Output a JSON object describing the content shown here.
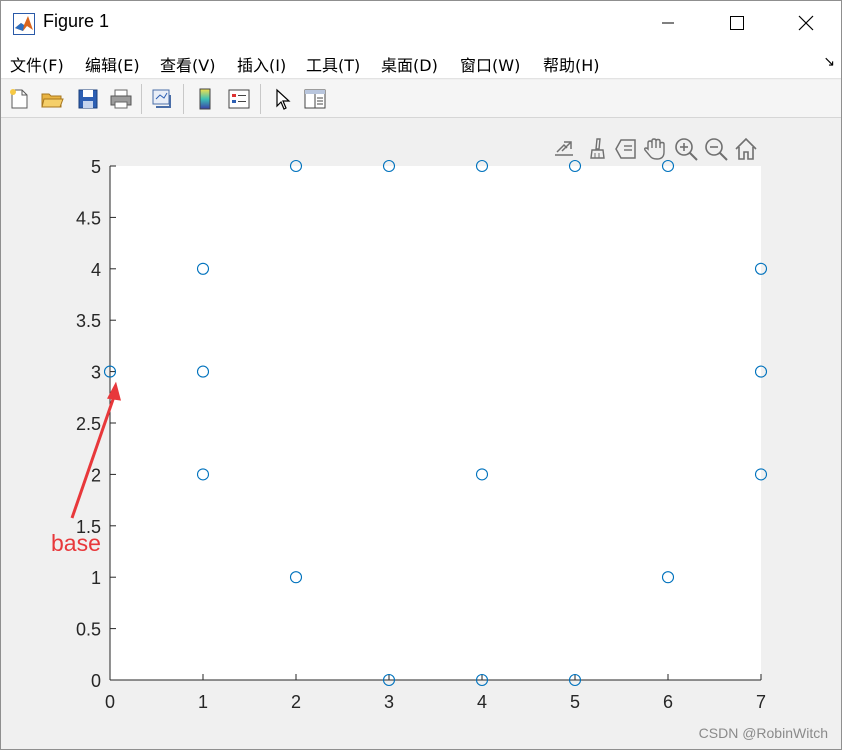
{
  "window": {
    "title": "Figure 1",
    "icon": "matlab-logo-icon"
  },
  "menu": [
    {
      "label": "文件(F)"
    },
    {
      "label": "编辑(E)"
    },
    {
      "label": "查看(V)"
    },
    {
      "label": "插入(I)"
    },
    {
      "label": "工具(T)"
    },
    {
      "label": "桌面(D)"
    },
    {
      "label": "窗口(W)"
    },
    {
      "label": "帮助(H)"
    }
  ],
  "toolbar": [
    "new-figure-icon",
    "open-file-icon",
    "save-icon",
    "print-icon",
    "link-plot-icon",
    "insert-colorbar-icon",
    "insert-legend-icon",
    "edit-plot-arrow-icon",
    "property-inspector-icon"
  ],
  "axes_toolbar": [
    "export-icon",
    "brush-icon",
    "data-tips-icon",
    "pan-hand-icon",
    "zoom-in-icon",
    "zoom-out-icon",
    "restore-view-home-icon"
  ],
  "annotation": {
    "text": "base",
    "color": "#e8383b"
  },
  "watermark": "CSDN @RobinWitch",
  "colors": {
    "marker": "#0072BD",
    "axes_bg": "#ffffff",
    "figure_bg": "#f0f0f0"
  },
  "chart_data": {
    "type": "scatter",
    "marker": "circle",
    "x": [
      0,
      1,
      1,
      1,
      2,
      2,
      3,
      3,
      4,
      4,
      4,
      5,
      5,
      6,
      6,
      7,
      7,
      7
    ],
    "y": [
      3,
      2,
      3,
      4,
      1,
      5,
      0,
      5,
      0,
      2,
      5,
      0,
      5,
      1,
      5,
      2,
      3,
      4
    ],
    "xlim": [
      0,
      7
    ],
    "ylim": [
      0,
      5
    ],
    "xticks": [
      "0",
      "1",
      "2",
      "3",
      "4",
      "5",
      "6",
      "7"
    ],
    "yticks": [
      "0",
      "0.5",
      "1",
      "1.5",
      "2",
      "2.5",
      "3",
      "3.5",
      "4",
      "4.5",
      "5"
    ],
    "grid": false
  }
}
